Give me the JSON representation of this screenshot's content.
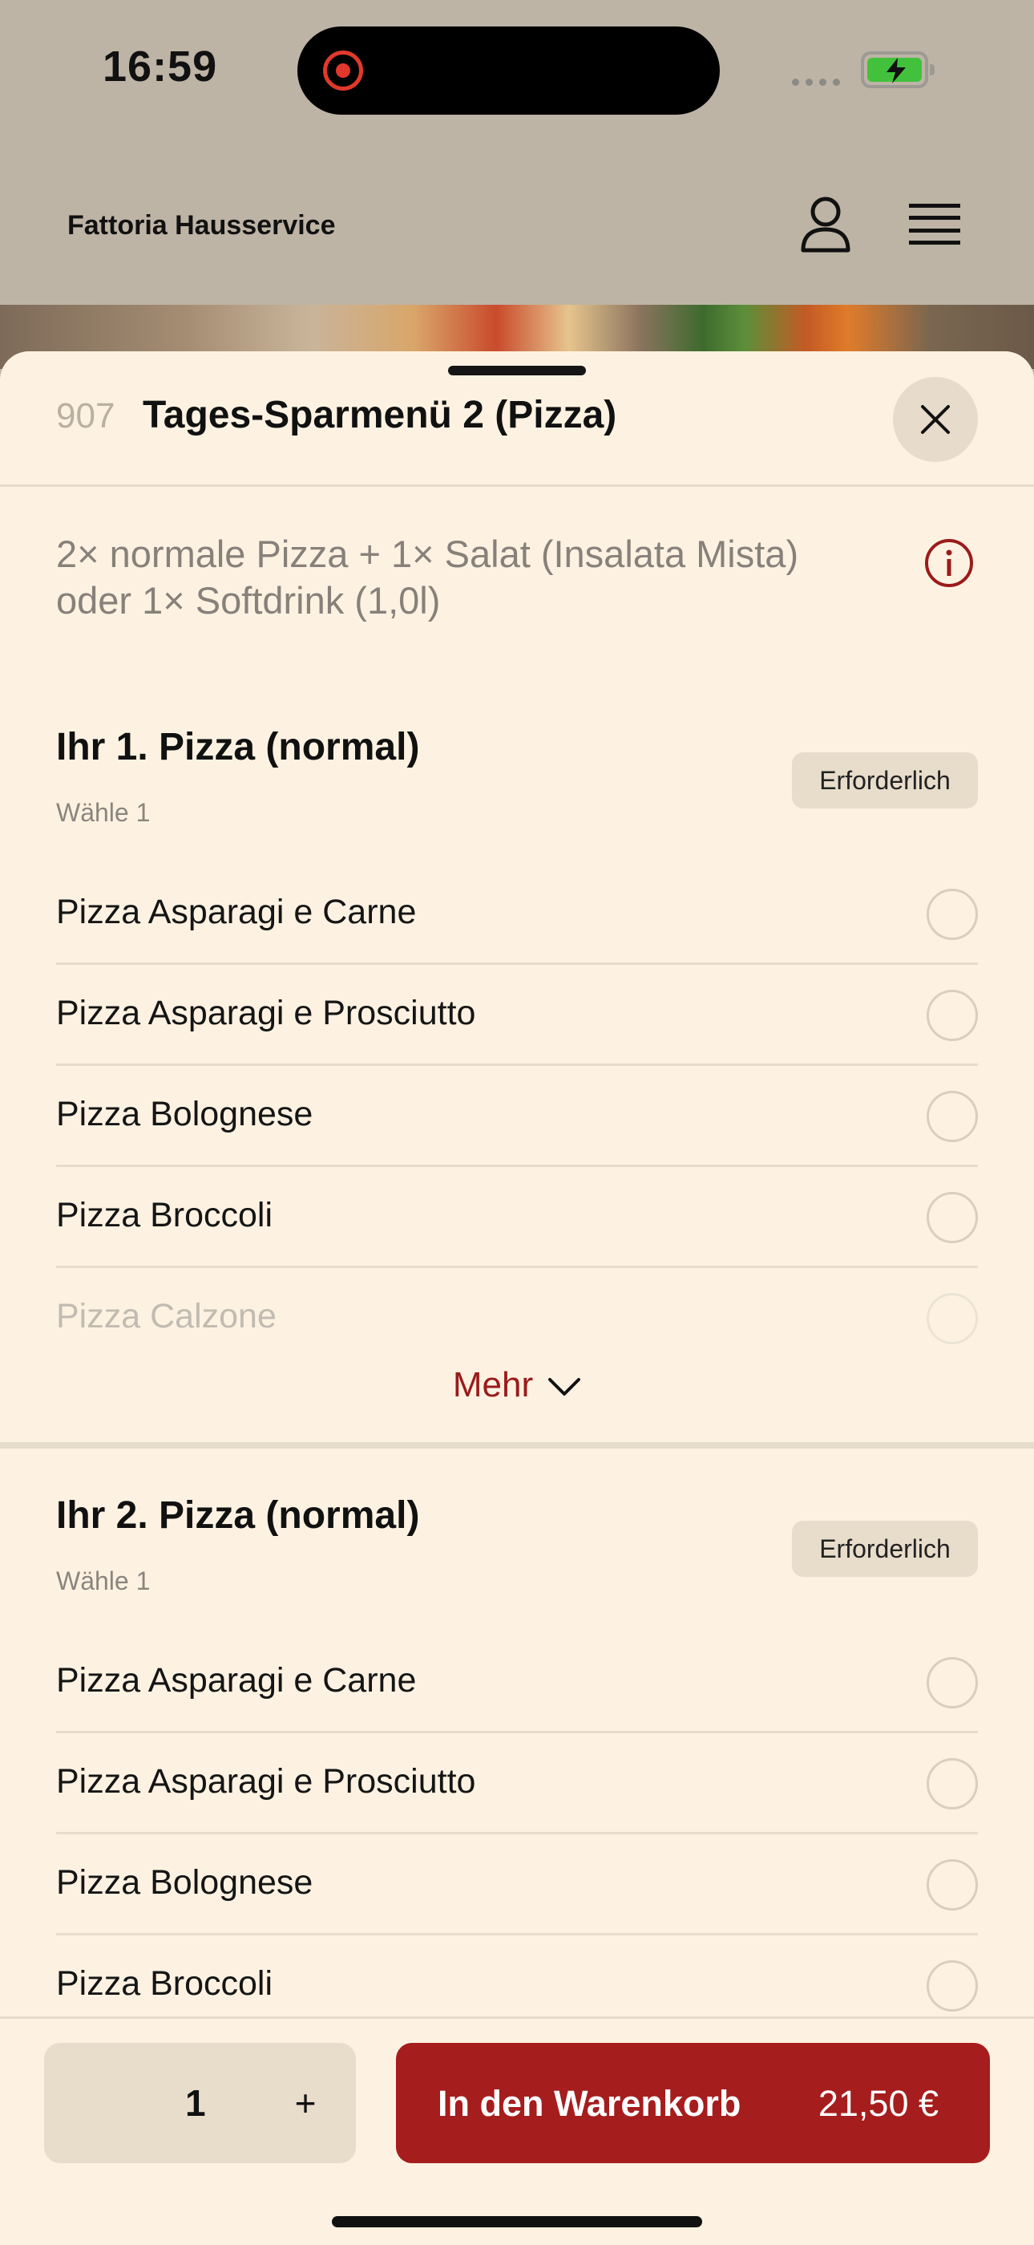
{
  "status_bar": {
    "time": "16:59",
    "battery_level": 0.8,
    "battery_color": "#42c13d",
    "recording_color": "#e2382c"
  },
  "header": {
    "brand": "Fattoria Hausservice",
    "account_icon": "person-icon",
    "menu_icon": "hamburger-icon"
  },
  "sheet": {
    "item_number": "907",
    "title": "Tages-Sparmenü 2 (Pizza)",
    "description": "2× normale Pizza + 1× Salat (Insalata Mista) oder 1× Softdrink (1,0l)",
    "groups": [
      {
        "title": "Ihr 1. Pizza (normal)",
        "subtitle": "Wähle 1",
        "badge": "Erforderlich",
        "options": [
          "Pizza Asparagi e Carne",
          "Pizza Asparagi e Prosciutto",
          "Pizza Bolognese",
          "Pizza Broccoli",
          "Pizza Calzone"
        ],
        "more_label": "Mehr"
      },
      {
        "title": "Ihr 2. Pizza (normal)",
        "subtitle": "Wähle 1",
        "badge": "Erforderlich",
        "options": [
          "Pizza Asparagi e Carne",
          "Pizza Asparagi e Prosciutto",
          "Pizza Bolognese",
          "Pizza Broccoli"
        ]
      }
    ]
  },
  "footer": {
    "quantity": "1",
    "plus_label": "+",
    "add_label": "In den Warenkorb",
    "price": "21,50 €",
    "accent_color": "#a61d1d"
  }
}
